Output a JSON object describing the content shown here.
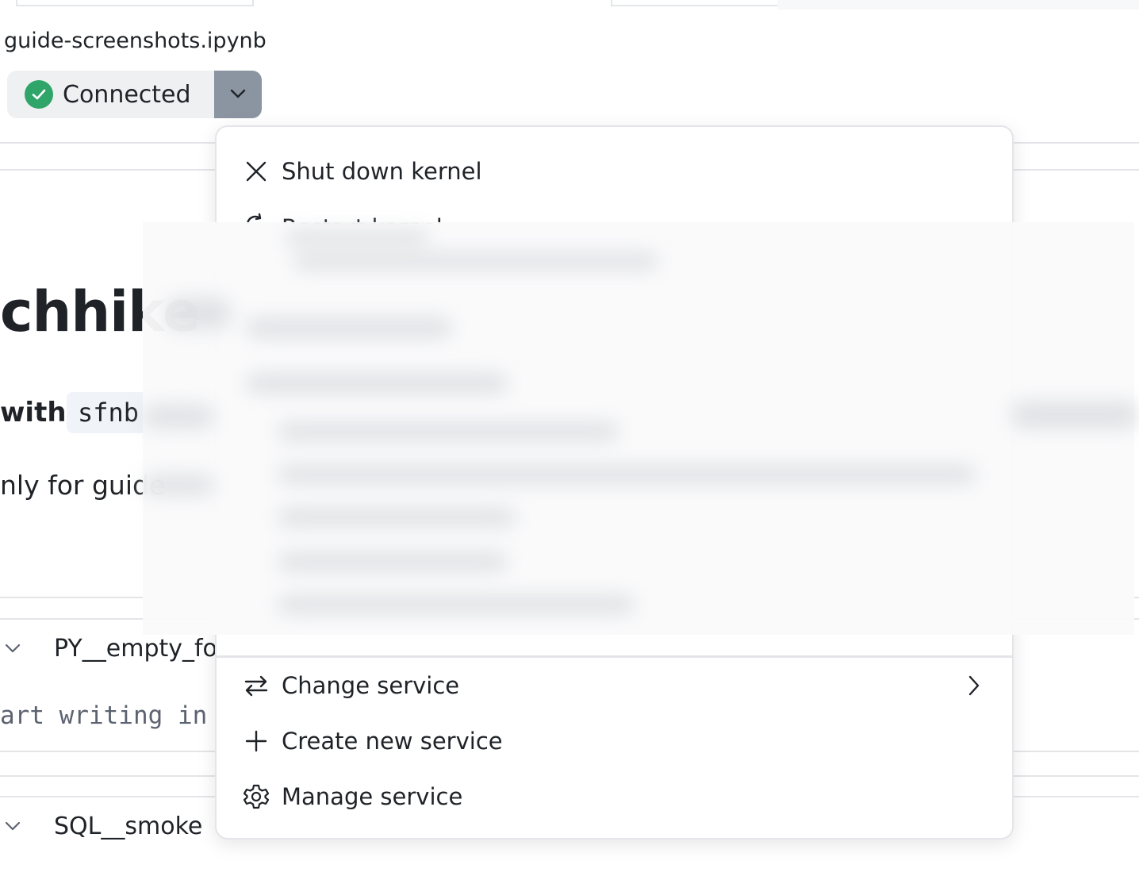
{
  "notebook": {
    "filename": "guide-screenshots.ipynb",
    "heading_fragment": "chhike",
    "sub_with": "with",
    "code_chip": "sfnb",
    "para_fragment": "nly for guide"
  },
  "connection": {
    "status_label": "Connected",
    "status_color": "#2fa56a",
    "caret_icon": "chevron-down-icon"
  },
  "cells": [
    {
      "name": "PY__empty_for",
      "code_preview": "art writing in"
    },
    {
      "name": "SQL__smoke"
    }
  ],
  "menu": {
    "items": [
      {
        "id": "shut-down-kernel",
        "label": "Shut down kernel",
        "icon": "close-icon"
      },
      {
        "id": "restart-kernel",
        "label": "Restart kernel",
        "icon": "restart-icon"
      },
      {
        "id": "change-service",
        "label": "Change service",
        "icon": "swap-icon",
        "submenu": true
      },
      {
        "id": "create-new-service",
        "label": "Create new service",
        "icon": "plus-icon"
      },
      {
        "id": "manage-service",
        "label": "Manage service",
        "icon": "gear-icon"
      }
    ]
  }
}
